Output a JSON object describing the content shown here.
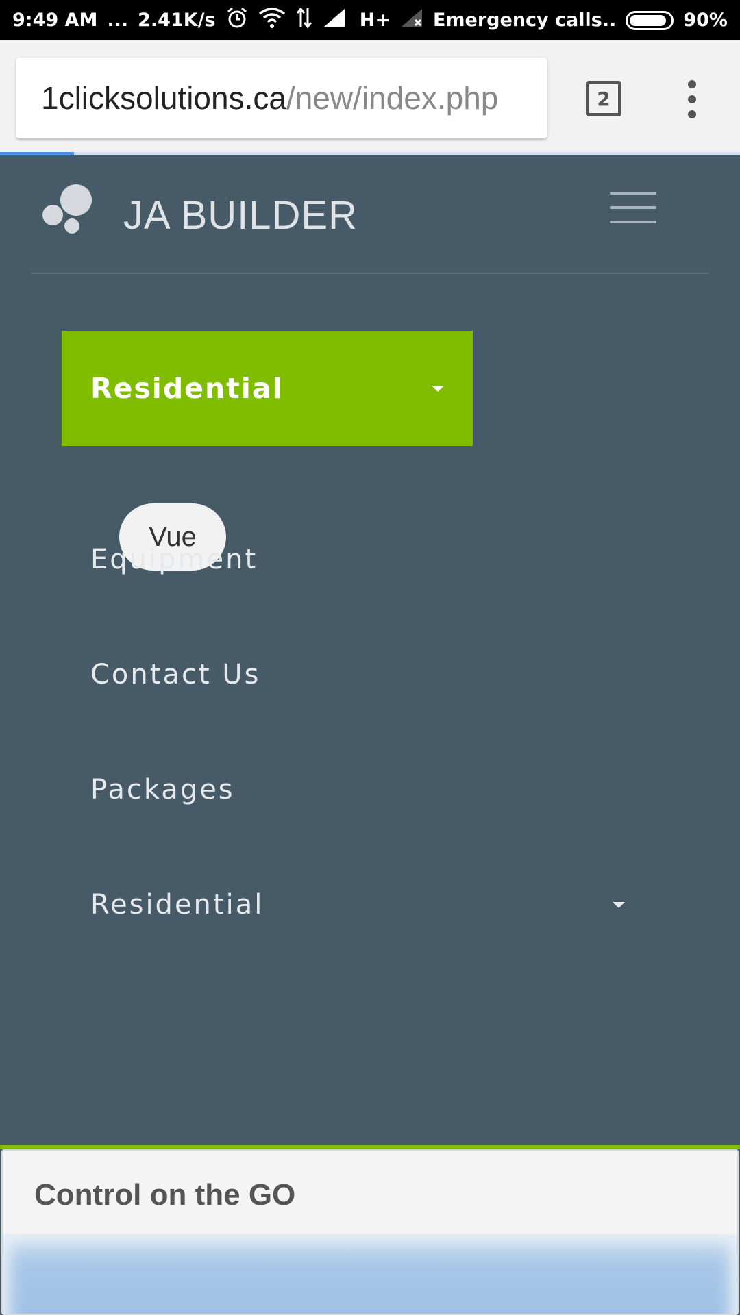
{
  "status_bar": {
    "time": "9:49 AM",
    "dots": "...",
    "speed": "2.41K/s",
    "network_type": "H+",
    "carrier": "Emergency calls..",
    "battery": "90%",
    "battery_level": 0.9
  },
  "browser": {
    "url_host": "1clicksolutions.ca",
    "url_path": "/new/index.php",
    "tab_count": "2",
    "load_progress": 0.1
  },
  "site": {
    "brand": "JA BUILDER",
    "nav": {
      "active_dropdown": "Residential",
      "pill": "Vue",
      "items": [
        {
          "label": "Equipment"
        },
        {
          "label": "Contact Us"
        },
        {
          "label": "Packages"
        },
        {
          "label": "Residential"
        }
      ]
    },
    "accent_color": "#80bc00",
    "background_color": "#475a68"
  },
  "card": {
    "title": "Control on the GO"
  }
}
